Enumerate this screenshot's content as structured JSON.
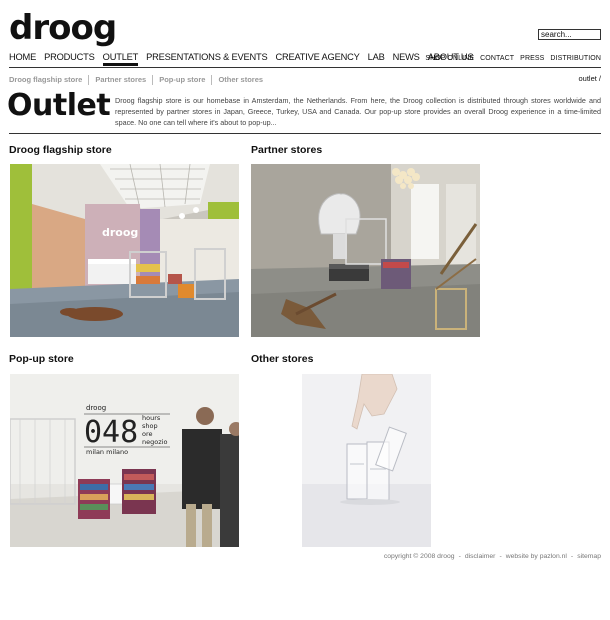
{
  "header": {
    "logo": "droog",
    "search_value": "search..."
  },
  "main_nav": [
    {
      "label": "HOME"
    },
    {
      "label": "PRODUCTS"
    },
    {
      "label": "OUTLET"
    },
    {
      "label": "PRESENTATIONS & EVENTS"
    },
    {
      "label": "CREATIVE AGENCY"
    },
    {
      "label": "LAB"
    },
    {
      "label": "NEWS"
    },
    {
      "label": "ABOUT US"
    }
  ],
  "sub_nav": [
    {
      "label": "SHOP ONLINE"
    },
    {
      "label": "CONTACT"
    },
    {
      "label": "PRESS"
    },
    {
      "label": "DISTRIBUTION"
    }
  ],
  "breadcrumb_tabs": [
    {
      "label": "Droog flagship store"
    },
    {
      "label": "Partner stores"
    },
    {
      "label": "Pop-up store"
    },
    {
      "label": "Other stores"
    }
  ],
  "path": "outlet /",
  "page": {
    "title": "Outlet",
    "intro": "Droog flagship store is our homebase in Amsterdam, the Netherlands. From here, the Droog collection is distributed through stores worldwide and represented by partner stores in Japan, Greece, Turkey, USA and Canada. Our pop-up store provides an overall Droog experience in a time-limited space. No one can tell where it's about to pop-up..."
  },
  "sections": {
    "flagship": {
      "title": "Droog flagship store"
    },
    "partner": {
      "title": "Partner stores"
    },
    "popup": {
      "title": "Pop-up store",
      "sign_brand": "droog",
      "sign_number": "048",
      "sign_words": [
        "hours",
        "shop",
        "ore",
        "negozio"
      ],
      "sign_city": "milan milano"
    },
    "other": {
      "title": "Other stores"
    }
  },
  "footer": {
    "copyright": "copyright © 2008 droog",
    "disclaimer": "disclaimer",
    "website": "website by pazlon.nl",
    "sitemap": "sitemap",
    "sep": "-"
  },
  "colors": {
    "accent": "#111111",
    "muted": "#999999"
  }
}
